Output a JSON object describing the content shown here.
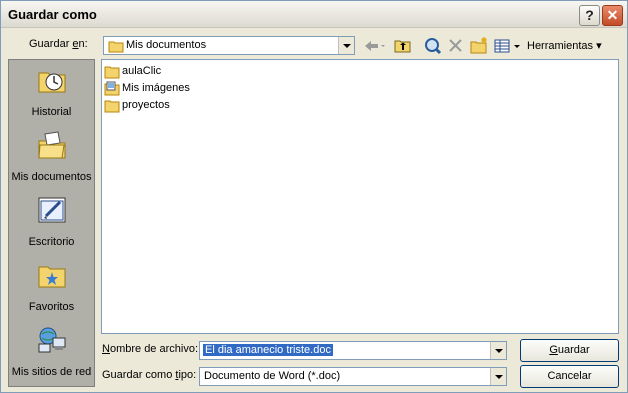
{
  "window": {
    "title": "Guardar como",
    "help_label": "?",
    "close_label": "✕"
  },
  "toolbar": {
    "save_in_label": "Guardar ",
    "save_in_accel": "e",
    "save_in_rest": "n:",
    "location_value": "Mis documentos",
    "tools_label": "Herramientas"
  },
  "places": [
    {
      "label": "Historial",
      "icon": "history-icon"
    },
    {
      "label": "Mis documentos",
      "icon": "my-documents-icon"
    },
    {
      "label": "Escritorio",
      "icon": "desktop-icon"
    },
    {
      "label": "Favoritos",
      "icon": "favorites-icon"
    },
    {
      "label": "Mis sitios de red",
      "icon": "network-places-icon"
    }
  ],
  "files": [
    {
      "name": "aulaClic",
      "icon": "folder-icon"
    },
    {
      "name": "Mis imágenes",
      "icon": "pictures-folder-icon"
    },
    {
      "name": "proyectos",
      "icon": "folder-icon"
    }
  ],
  "form": {
    "filename_label_pre": "",
    "filename_accel": "N",
    "filename_label_rest": "ombre de archivo:",
    "filename_value": "El dia amanecio triste.doc",
    "filetype_label_pre": "Guardar como ",
    "filetype_accel": "t",
    "filetype_label_rest": "ipo:",
    "filetype_value": "Documento de Word (*.doc)"
  },
  "buttons": {
    "save_accel": "G",
    "save_rest": "uardar",
    "cancel": "Cancelar"
  }
}
